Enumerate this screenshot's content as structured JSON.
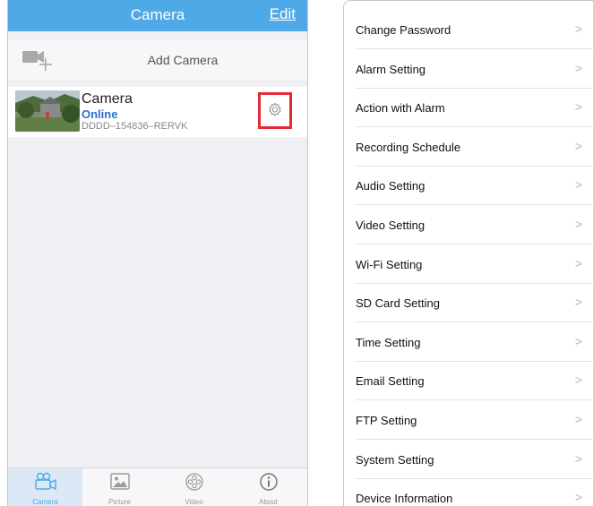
{
  "left_screen": {
    "navbar": {
      "title": "Camera",
      "edit_label": "Edit"
    },
    "add_camera": {
      "label": "Add Camera",
      "icon": "video-camera-add-icon"
    },
    "camera": {
      "name": "Camera",
      "status": "Online",
      "uid": "DDDD–154836–RERVK",
      "thumbnail": "camera-thumbnail",
      "settings_icon": "gear-icon",
      "status_color": "#2e6fd1",
      "highlight_color": "#e52a33"
    },
    "tabs": [
      {
        "label": "Camera",
        "icon": "camera-tab-icon",
        "active": true
      },
      {
        "label": "Picture",
        "icon": "picture-tab-icon",
        "active": false
      },
      {
        "label": "Video",
        "icon": "video-tab-icon",
        "active": false
      },
      {
        "label": "About",
        "icon": "info-icon",
        "active": false
      }
    ],
    "accent_color": "#4fa9e6"
  },
  "right_screen": {
    "settings_items": [
      {
        "label": "Change Password",
        "chevron": ">"
      },
      {
        "label": "Alarm Setting",
        "chevron": ">"
      },
      {
        "label": "Action with Alarm",
        "chevron": ">"
      },
      {
        "label": "Recording Schedule",
        "chevron": ">"
      },
      {
        "label": "Audio Setting",
        "chevron": ">"
      },
      {
        "label": "Video Setting",
        "chevron": ">"
      },
      {
        "label": "Wi-Fi Setting",
        "chevron": ">"
      },
      {
        "label": "SD Card Setting",
        "chevron": ">"
      },
      {
        "label": "Time Setting",
        "chevron": ">"
      },
      {
        "label": "Email Setting",
        "chevron": ">"
      },
      {
        "label": "FTP Setting",
        "chevron": ">"
      },
      {
        "label": "System Setting",
        "chevron": ">"
      },
      {
        "label": "Device Information",
        "chevron": ">"
      }
    ]
  }
}
